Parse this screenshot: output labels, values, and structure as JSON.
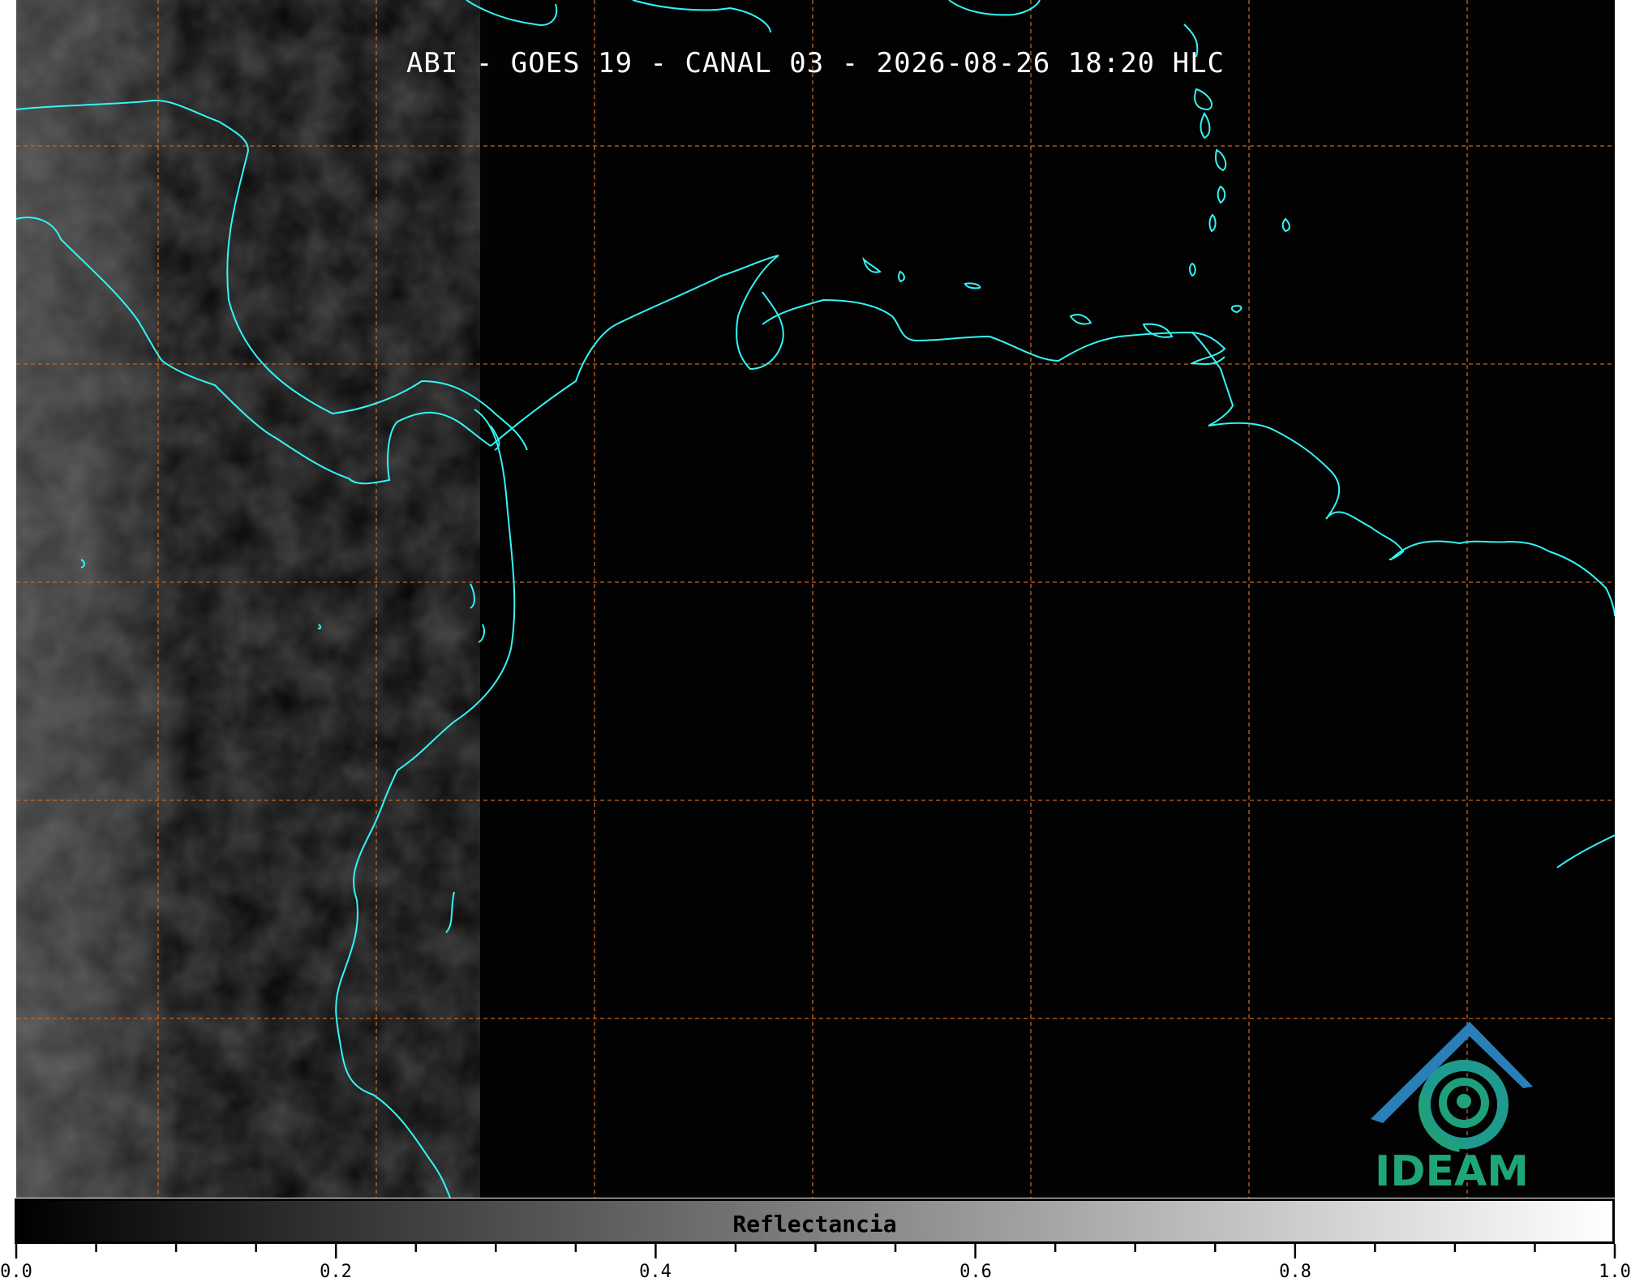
{
  "title": "ABI - GOES 19 - CANAL 03 - 2026-08-26 18:20 HLC",
  "colorbar": {
    "label": "Reflectancia",
    "range": [
      0.0,
      1.0
    ],
    "colors": [
      "#000000",
      "#ffffff"
    ],
    "tick_labels": [
      "0.0",
      "0.2",
      "0.4",
      "0.6",
      "0.8",
      "1.0"
    ]
  },
  "logo": {
    "text": "IDEAM",
    "colors": {
      "roof": "#2b7fb8",
      "spiral": "#1fa08a",
      "text": "#1fa57a"
    }
  },
  "map": {
    "coastline_color": "#33f5f5",
    "gridline_color": "#c8641e",
    "gridline_style": "dashed",
    "background": "#020202"
  }
}
